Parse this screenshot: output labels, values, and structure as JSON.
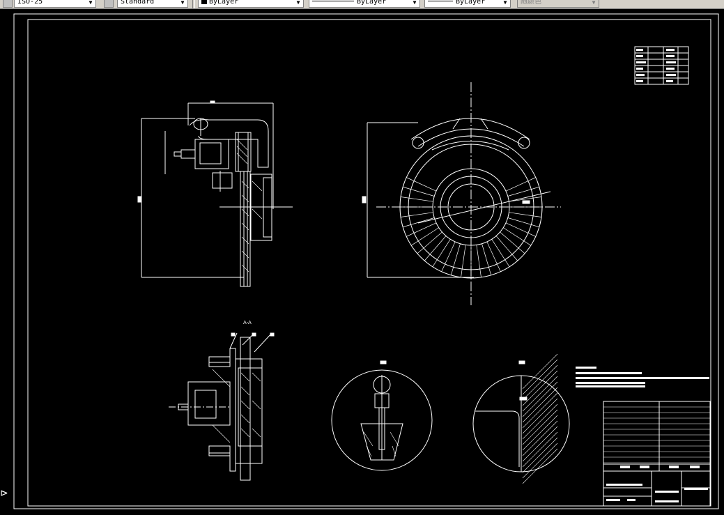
{
  "toolbar": {
    "dimstyle_value": "ISO-25",
    "textstyle_value": "Standard",
    "layer_color_value": "ByLayer",
    "linetype_value": "ByLayer",
    "lineweight_value": "ByLayer",
    "plotstyle_value": "随颜色"
  },
  "drawing": {
    "background": "#000000",
    "line_color": "#ffffff",
    "section_label_aa": "A-A"
  }
}
